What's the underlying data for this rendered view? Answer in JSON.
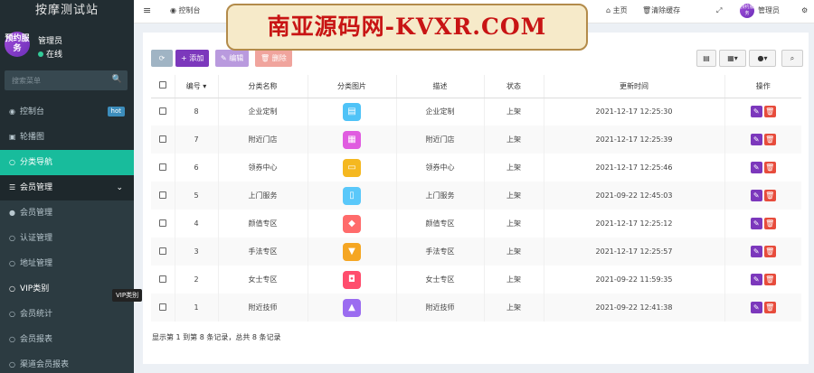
{
  "app": {
    "title": "按摩测试站"
  },
  "user": {
    "avatar_text": "预约服务",
    "name": "管理员",
    "status": "在线"
  },
  "sidebar": {
    "search_placeholder": "搜索菜单",
    "items": [
      {
        "label": "控制台",
        "icon": "dashboard-icon",
        "badge": "hot"
      },
      {
        "label": "轮播图",
        "icon": "image-icon"
      },
      {
        "label": "分类导航",
        "icon": "circle-icon",
        "active": true
      },
      {
        "label": "会员管理",
        "icon": "list-icon",
        "expanded": true
      },
      {
        "label": "会员管理",
        "icon": "user-icon"
      },
      {
        "label": "认证管理",
        "icon": "circle-icon"
      },
      {
        "label": "地址管理",
        "icon": "circle-icon"
      },
      {
        "label": "VIP类别",
        "icon": "circle-icon"
      },
      {
        "label": "会员统计",
        "icon": "circle-icon"
      },
      {
        "label": "会员报表",
        "icon": "circle-icon"
      },
      {
        "label": "渠道会员报表",
        "icon": "circle-icon"
      }
    ],
    "tooltip": "VIP类别"
  },
  "topbar": {
    "menu_icon": "hamburger-icon",
    "dashboard": "控制台",
    "home": "主页",
    "clear_cache": "清除缓存",
    "admin": "管理员"
  },
  "watermark": {
    "text": "南亚源码网-KVXR.COM"
  },
  "toolbar": {
    "add": "添加",
    "edit": "编辑",
    "delete": "删除"
  },
  "table": {
    "headers": [
      "编号",
      "分类名称",
      "分类图片",
      "描述",
      "状态",
      "更新时间",
      "操作"
    ],
    "rows": [
      {
        "id": "8",
        "name": "企业定制",
        "icon_color": "#4fc3f7",
        "desc": "企业定制",
        "status": "上架",
        "time": "2021-12-17 12:25:30"
      },
      {
        "id": "7",
        "name": "附近门店",
        "icon_color": "#e05ce0",
        "desc": "附近门店",
        "status": "上架",
        "time": "2021-12-17 12:25:39"
      },
      {
        "id": "6",
        "name": "领券中心",
        "icon_color": "#f5b820",
        "desc": "领券中心",
        "status": "上架",
        "time": "2021-12-17 12:25:46"
      },
      {
        "id": "5",
        "name": "上门服务",
        "icon_color": "#5ac8fa",
        "desc": "上门服务",
        "status": "上架",
        "time": "2021-09-22 12:45:03"
      },
      {
        "id": "4",
        "name": "颜值专区",
        "icon_color": "#ff6b6b",
        "desc": "颜值专区",
        "status": "上架",
        "time": "2021-12-17 12:25:12"
      },
      {
        "id": "3",
        "name": "手法专区",
        "icon_color": "#f5a623",
        "desc": "手法专区",
        "status": "上架",
        "time": "2021-12-17 12:25:57"
      },
      {
        "id": "2",
        "name": "女士专区",
        "icon_color": "#ff4d6d",
        "desc": "女士专区",
        "status": "上架",
        "time": "2021-09-22 11:59:35"
      },
      {
        "id": "1",
        "name": "附近技师",
        "icon_color": "#9b6cf0",
        "desc": "附近技师",
        "status": "上架",
        "time": "2021-09-22 12:41:38"
      }
    ]
  },
  "footer": {
    "summary": "显示第 1 到第 8 条记录，总共 8 条记录"
  }
}
